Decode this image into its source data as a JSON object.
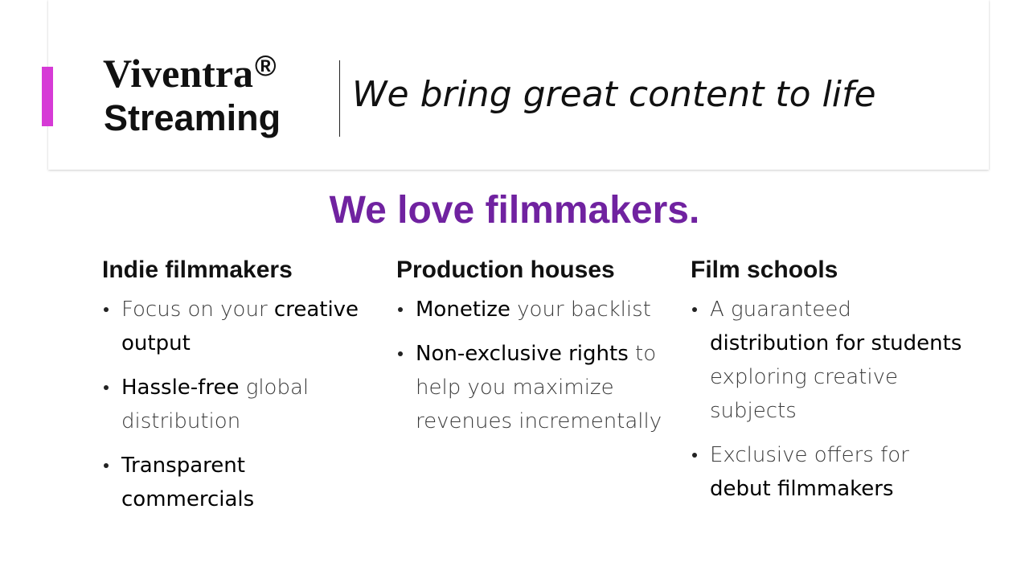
{
  "header": {
    "brand_name": "Viventra",
    "brand_mark": "®",
    "brand_sub": "Streaming",
    "tagline": "We bring great content to life",
    "accent_color": "#d63ad6"
  },
  "headline": {
    "text": "We love filmmakers.",
    "color": "#7022a0"
  },
  "columns": [
    {
      "title": "Indie filmmakers",
      "items": [
        {
          "light": "Focus on your ",
          "strong": "creative output",
          "tail": ""
        },
        {
          "light": "",
          "strong": "Hassle-free",
          "tail": " global distribution"
        },
        {
          "light": "",
          "strong": "Transparent commercials",
          "tail": ""
        }
      ]
    },
    {
      "title": "Production houses",
      "items": [
        {
          "light": "",
          "strong": "Monetize",
          "tail": " your backlist"
        },
        {
          "light": "",
          "strong": "Non-exclusive rights",
          "tail": " to help you maximize revenues incrementally"
        }
      ]
    },
    {
      "title": "Film schools",
      "items": [
        {
          "light": "A guaranteed ",
          "strong": "distribution for students",
          "tail": " exploring creative subjects"
        },
        {
          "light": "Exclusive offers for ",
          "strong": "debut filmmakers",
          "tail": ""
        }
      ]
    }
  ]
}
